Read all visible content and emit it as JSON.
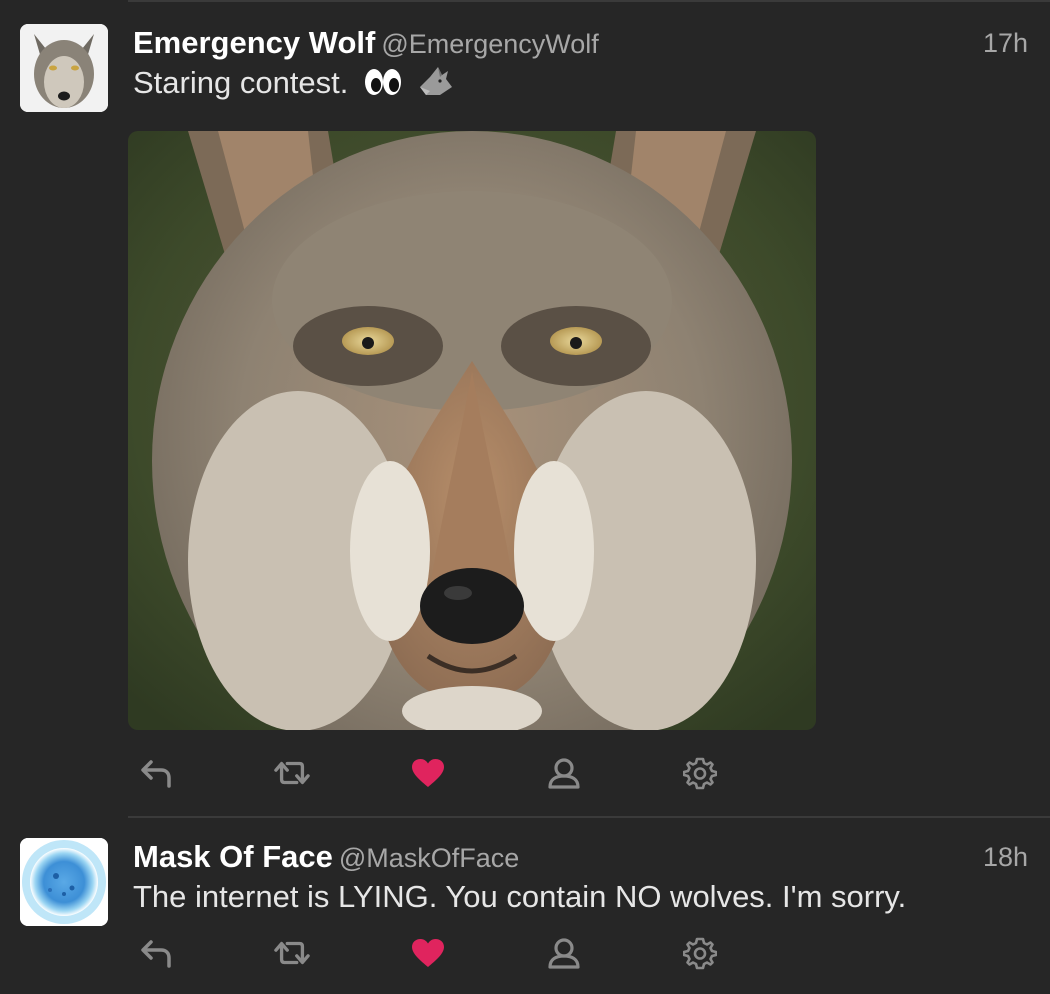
{
  "tweets": [
    {
      "display_name": "Emergency Wolf",
      "handle": "@EmergencyWolf",
      "time": "17h",
      "text": "Staring contest.",
      "emoji": [
        "eyes-emoji",
        "wolf-emoji"
      ],
      "has_media": true,
      "media_subject": "wolf-face-photo",
      "liked": true
    },
    {
      "display_name": "Mask Of Face",
      "handle": "@MaskOfFace",
      "time": "18h",
      "text": "The internet is LYING. You contain NO wolves. I'm sorry.",
      "has_media": false,
      "liked": true
    }
  ],
  "actions": [
    "reply-icon",
    "retweet-icon",
    "heart-icon",
    "profile-icon",
    "gear-icon"
  ],
  "colors": {
    "background": "#262626",
    "name": "#ffffff",
    "secondary_text": "#a7a7a7",
    "icon": "#8a8a8a",
    "heart_liked": "#e0245e"
  }
}
